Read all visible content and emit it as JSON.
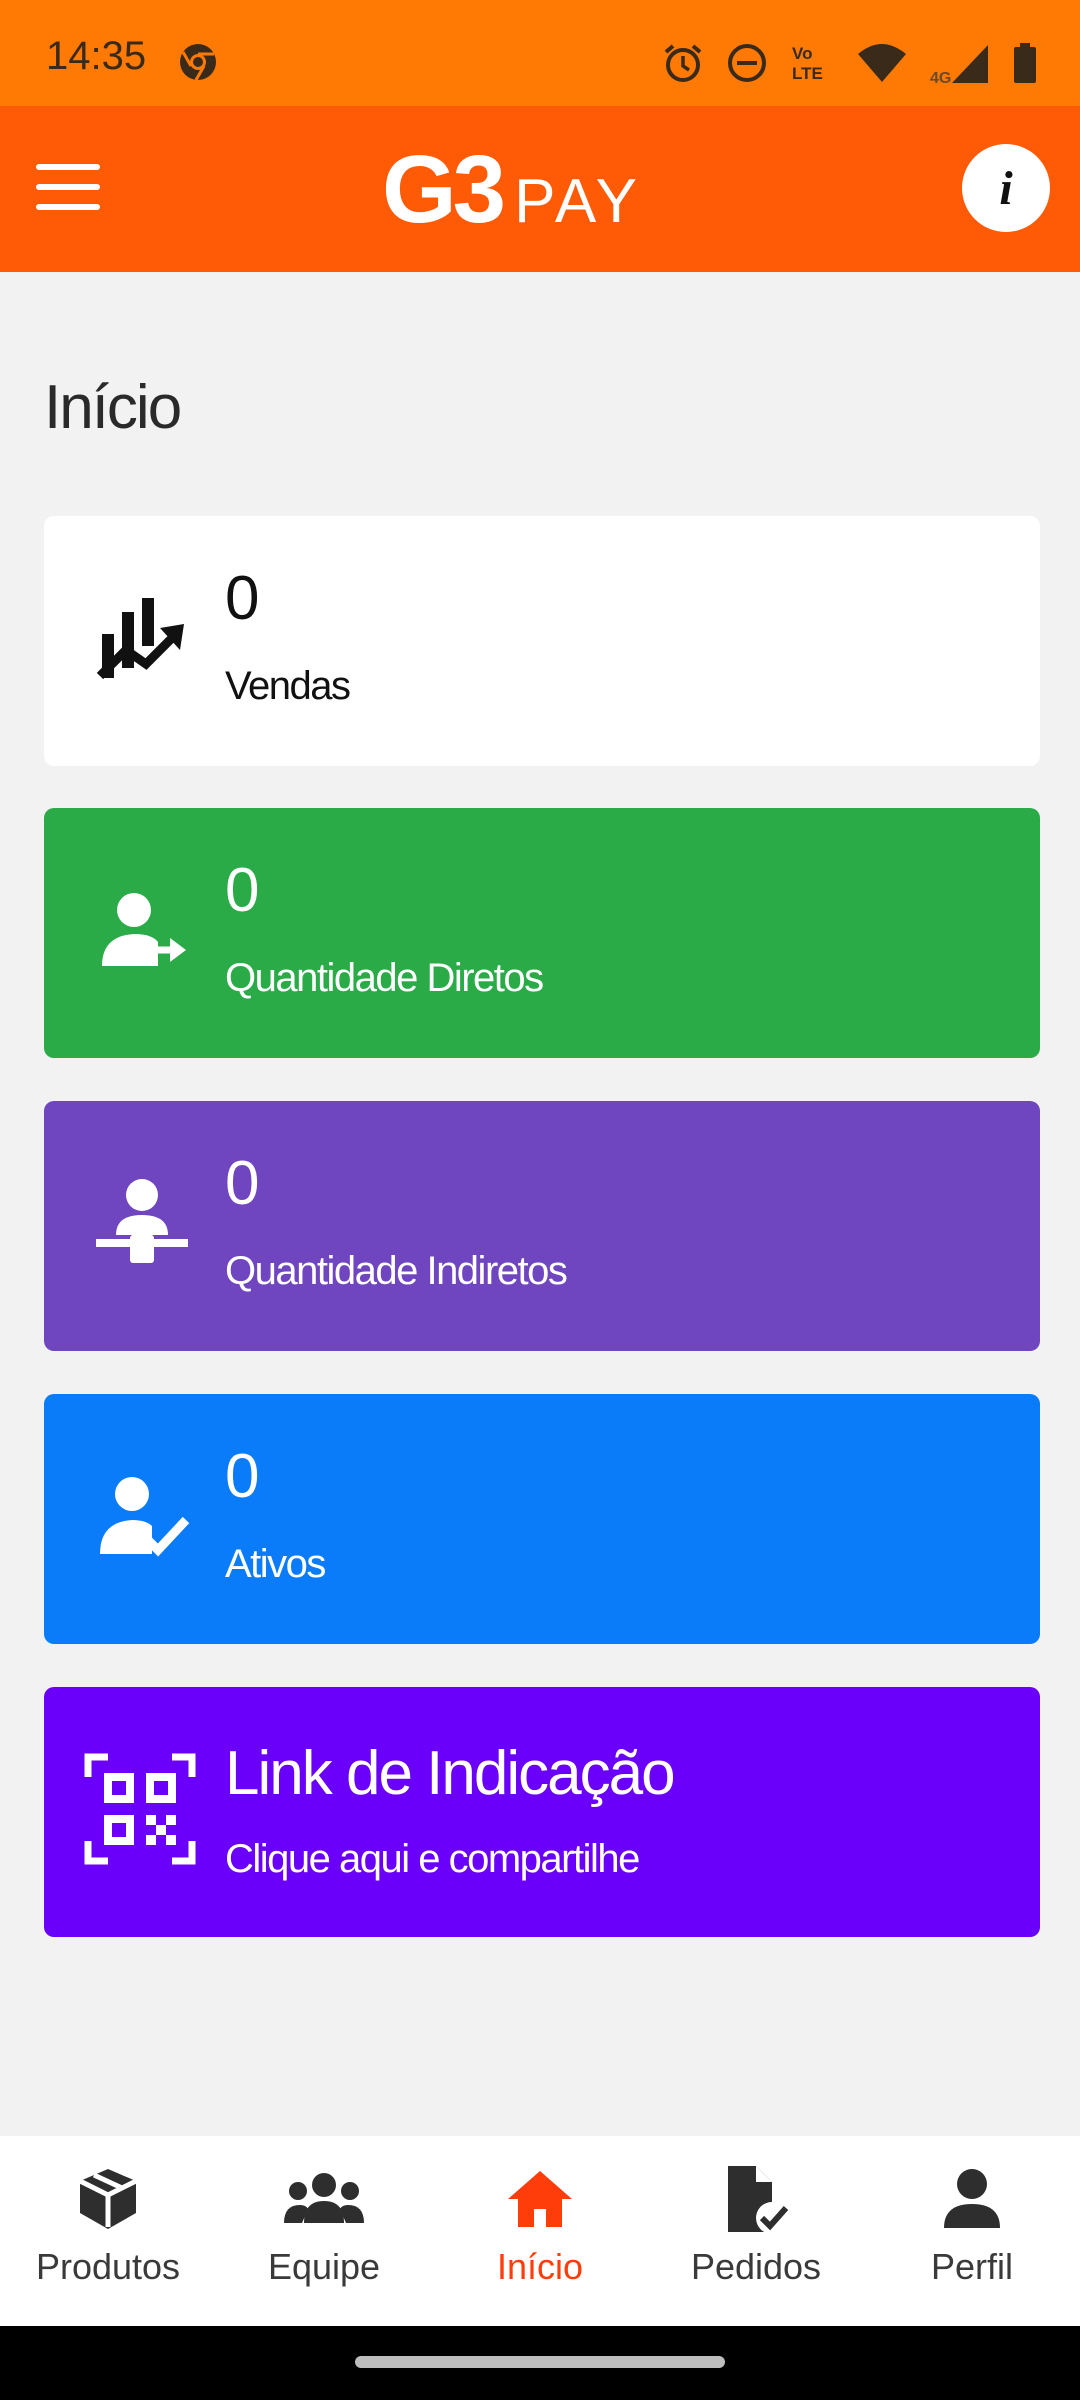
{
  "status_bar": {
    "time": "14:35",
    "icons": [
      "chrome-icon",
      "alarm-icon",
      "do-not-disturb-icon",
      "volte-icon",
      "wifi-icon",
      "signal-4g-icon",
      "battery-icon"
    ]
  },
  "header": {
    "logo_main": "G3",
    "logo_sub": "PAY",
    "menu_icon": "hamburger-menu-icon",
    "info_icon": "info-icon",
    "info_glyph": "i"
  },
  "page": {
    "title": "Início"
  },
  "cards": [
    {
      "value": "0",
      "label": "Vendas",
      "icon": "sales-chart-icon",
      "color": "#ffffff"
    },
    {
      "value": "0",
      "label": "Quantidade Diretos",
      "icon": "user-arrow-icon",
      "color": "#2aab48"
    },
    {
      "value": "0",
      "label": "Quantidade Indiretos",
      "icon": "user-network-icon",
      "color": "#6f45c0"
    },
    {
      "value": "0",
      "label": "Ativos",
      "icon": "user-check-icon",
      "color": "#0a7cf9"
    },
    {
      "value": "Link de Indicação",
      "label": "Clique aqui e compartilhe",
      "icon": "qr-code-icon",
      "color": "#6b00fa"
    }
  ],
  "bottom_nav": {
    "items": [
      {
        "label": "Produtos",
        "icon": "box-icon",
        "active": false
      },
      {
        "label": "Equipe",
        "icon": "team-icon",
        "active": false
      },
      {
        "label": "Início",
        "icon": "home-icon",
        "active": true
      },
      {
        "label": "Pedidos",
        "icon": "document-check-icon",
        "active": false
      },
      {
        "label": "Perfil",
        "icon": "person-icon",
        "active": false
      }
    ],
    "active_color": "#ff3d0a"
  },
  "colors": {
    "status_bar": "#ff7a05",
    "header": "#ff5a06",
    "background": "#f2f2f3"
  }
}
